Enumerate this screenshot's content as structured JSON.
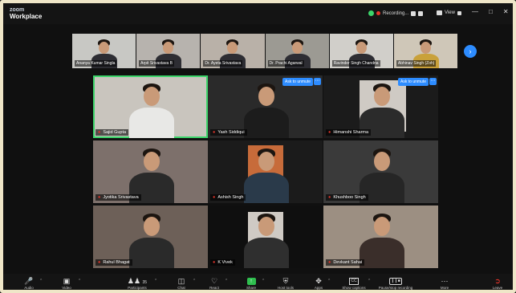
{
  "app": {
    "logo_line1": "zoom",
    "logo_line2": "Workplace"
  },
  "titlebar": {
    "recording_text": "Recording...",
    "view_label": "View"
  },
  "filmstrip": [
    {
      "name": "Ananya Kumar Singla"
    },
    {
      "name": "Arpit Srivastava B"
    },
    {
      "name": "Dr. Ayeta Srivastava"
    },
    {
      "name": "Dr. Prachi Agarwal"
    },
    {
      "name": "Ravinder Singh Chandna"
    },
    {
      "name": "Abhinav Singh (Zoh)"
    }
  ],
  "gallery": [
    {
      "name": "Sajid Gupta",
      "active": true,
      "ask": false
    },
    {
      "name": "Yash Siddiqui",
      "active": false,
      "ask": true
    },
    {
      "name": "Himanshi Sharma",
      "active": false,
      "ask": true
    },
    {
      "name": "Jyotika Srivastava",
      "active": false,
      "ask": false
    },
    {
      "name": "Ashish Singh",
      "active": false,
      "ask": false
    },
    {
      "name": "Khushboo Singh",
      "active": false,
      "ask": false
    },
    {
      "name": "Rahul Bhagat",
      "active": false,
      "ask": false
    },
    {
      "name": "K Vivek",
      "active": false,
      "ask": false
    },
    {
      "name": "Devkant Sahai",
      "active": false,
      "ask": false
    }
  ],
  "ask_label": "Ask to unmute",
  "toolbar": {
    "audio": "Audio",
    "video": "Video",
    "participants": "Participants",
    "participants_count": "35",
    "chat": "Chat",
    "react": "React",
    "share": "Share",
    "host_tools": "Host tools",
    "apps": "Apps",
    "captions": "Show captions",
    "recording": "Pause/stop recording",
    "more": "More",
    "leave": "Leave"
  },
  "colors": {
    "accent": "#2d8cff",
    "active_speaker": "#3cd46a",
    "leave": "#e5352b",
    "share": "#2fbf4f"
  }
}
